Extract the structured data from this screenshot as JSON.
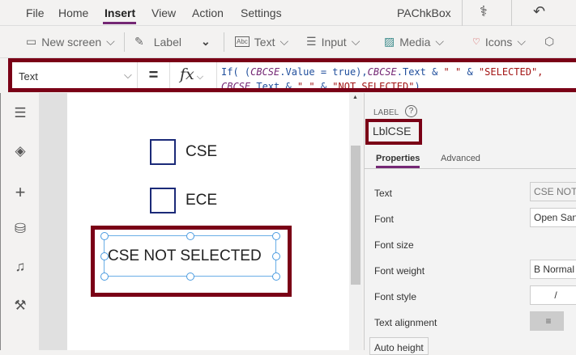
{
  "menu": {
    "items": [
      "File",
      "Home",
      "Insert",
      "View",
      "Action",
      "Settings"
    ],
    "active": "Insert",
    "app_name": "PAChkBox"
  },
  "toolbar": {
    "new_screen": "New screen",
    "label": "Label",
    "text": "Text",
    "input": "Input",
    "media": "Media",
    "icons": "Icons"
  },
  "formula": {
    "property": "Text",
    "equals": "=",
    "fx": "fx",
    "line1_a": "If( (",
    "v1": "CBCSE",
    "line1_b": ".Value = true),",
    "v2": "CBCSE",
    "line1_c": ".Text & ",
    "s1": "\" \"",
    "amp": " & ",
    "s2": "\"SELECTED\",",
    "line2_v": "CBCSE",
    "line2_b": ".Text & ",
    "line2_s1": "\" \"",
    "line2_amp": " & ",
    "line2_s2": "\"NOT SELECTED\"",
    "line2_end": ")"
  },
  "canvas": {
    "checkboxes": [
      {
        "label": "CSE",
        "checked": false
      },
      {
        "label": "ECE",
        "checked": false
      }
    ],
    "label_text": "CSE NOT SELECTED"
  },
  "panel": {
    "type": "LABEL",
    "name": "LblCSE",
    "tabs": [
      "Properties",
      "Advanced"
    ],
    "active_tab": "Properties",
    "props": [
      {
        "label": "Text",
        "value": "CSE NOT SELECTED"
      },
      {
        "label": "Font",
        "value": "Open Sans"
      },
      {
        "label": "Font size",
        "value": ""
      },
      {
        "label": "Font weight",
        "value": "B  Normal"
      },
      {
        "label": "Font style",
        "value": "/"
      },
      {
        "label": "Text alignment",
        "value": "≡"
      }
    ],
    "auto_height": "Auto height"
  },
  "colors": {
    "accent": "#742774",
    "highlight": "#7a0016",
    "checkbox": "#1b2a78",
    "selection": "#6aaee6"
  }
}
